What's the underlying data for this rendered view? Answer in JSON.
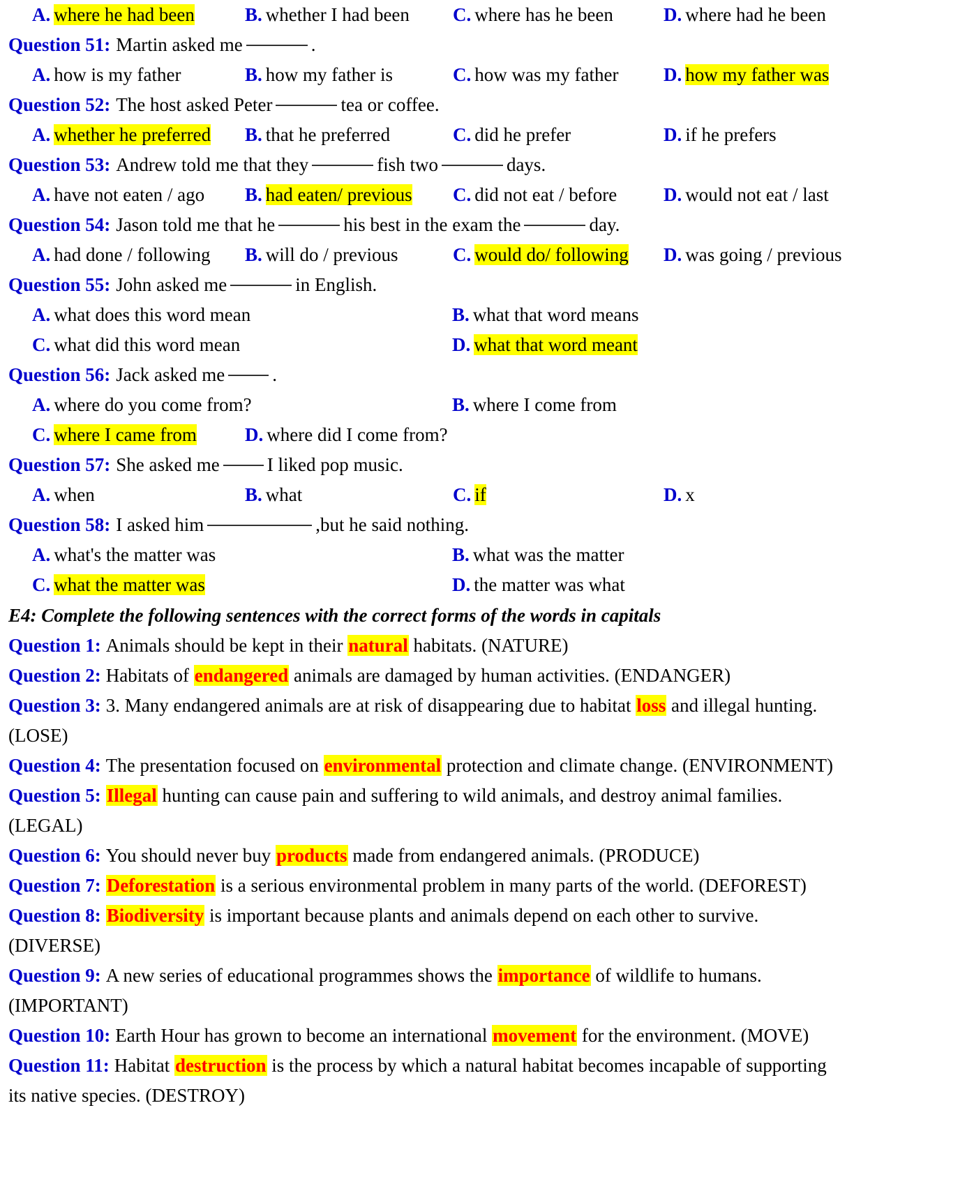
{
  "document": {
    "colors": {
      "question_label": "#0000CC",
      "option_letter": "#0000CC",
      "highlight": "#FFFF00",
      "answer_word": "#FF0000",
      "body_text": "#000000"
    }
  },
  "top_options": {
    "a": {
      "letter": "A.",
      "text": "where he had been"
    },
    "b": {
      "letter": "B.",
      "text": "whether I had been"
    },
    "c": {
      "letter": "C.",
      "text": "where has he been"
    },
    "d": {
      "letter": "D.",
      "text": "where had he been"
    }
  },
  "questions": [
    {
      "label": "Question 51:",
      "stem_before": "Martin asked me",
      "stem_after": ".",
      "options": [
        {
          "letter": "A.",
          "text": "how is my father"
        },
        {
          "letter": "B.",
          "text": "how my father is"
        },
        {
          "letter": "C.",
          "text": "how was my father"
        },
        {
          "letter": "D.",
          "text": "how my father was"
        }
      ]
    },
    {
      "label": "Question 52:",
      "stem_before": "The host asked Peter",
      "stem_after": "tea or coffee.",
      "options": [
        {
          "letter": "A.",
          "text": "whether he preferred"
        },
        {
          "letter": "B.",
          "text": "that he preferred"
        },
        {
          "letter": "C.",
          "text": "did he prefer"
        },
        {
          "letter": "D.",
          "text": "if he prefers"
        }
      ]
    },
    {
      "label": "Question 53:",
      "stem_before": "Andrew told me that they",
      "stem_mid": "fish two",
      "stem_after": "days.",
      "options": [
        {
          "letter": "A.",
          "text": "have not eaten / ago"
        },
        {
          "letter": "B.",
          "text": "had eaten/ previous"
        },
        {
          "letter": "C.",
          "text": "did not eat / before"
        },
        {
          "letter": "D.",
          "text": "would not eat / last"
        }
      ]
    },
    {
      "label": "Question 54:",
      "stem_before": "Jason told me that he",
      "stem_mid": "his best in the exam the",
      "stem_after": "day.",
      "options": [
        {
          "letter": "A.",
          "text": "had done / following"
        },
        {
          "letter": "B.",
          "text": "will do / previous"
        },
        {
          "letter": "C.",
          "text": "would do/ following"
        },
        {
          "letter": "D.",
          "text": "was going / previous"
        }
      ]
    },
    {
      "label": "Question 55:",
      "stem_before": "John asked me",
      "stem_after": "in English.",
      "options": [
        {
          "letter": "A.",
          "text": "what does this word mean"
        },
        {
          "letter": "B.",
          "text": "what that word means"
        },
        {
          "letter": "C.",
          "text": "what did this word mean"
        },
        {
          "letter": "D.",
          "text": "what that word meant"
        }
      ]
    },
    {
      "label": "Question 56:",
      "stem_before": "Jack asked me",
      "stem_after": ".",
      "options": [
        {
          "letter": "A.",
          "text": "where do you come from?"
        },
        {
          "letter": "B.",
          "text": "where I come from"
        },
        {
          "letter": "C.",
          "text": "where I came from"
        },
        {
          "letter": "D.",
          "text": "where did I come from?"
        }
      ]
    },
    {
      "label": "Question 57:",
      "stem_before": "She asked me",
      "stem_after": "I liked pop music.",
      "options": [
        {
          "letter": "A.",
          "text": "when"
        },
        {
          "letter": "B.",
          "text": "what"
        },
        {
          "letter": "C.",
          "text": "if"
        },
        {
          "letter": "D.",
          "text": "x"
        }
      ]
    },
    {
      "label": "Question 58:",
      "stem_before": "I asked him",
      "stem_after": ",but he said nothing.",
      "options": [
        {
          "letter": "A.",
          "text": "what's the matter was"
        },
        {
          "letter": "B.",
          "text": "what was the matter"
        },
        {
          "letter": "C.",
          "text": "what the matter was"
        },
        {
          "letter": "D.",
          "text": "the matter was what"
        }
      ]
    }
  ],
  "e4": {
    "heading": "E4: Complete the following sentences with the correct forms of the words in capitals",
    "items": [
      {
        "label": "Question 1:",
        "before": "Animals should be kept in their ",
        "answer": "natural",
        "after": " habitats. (NATURE)",
        "continuation": ""
      },
      {
        "label": "Question 2:",
        "before": "Habitats of ",
        "answer": "endangered",
        "after": " animals are damaged by human activities. (ENDANGER)",
        "continuation": ""
      },
      {
        "label": "Question 3:",
        "before": "3. Many endangered animals are at risk of disappearing due to habitat ",
        "answer": "loss",
        "after": " and illegal hunting.",
        "continuation": "(LOSE)"
      },
      {
        "label": "Question 4:",
        "before": "The presentation focused on ",
        "answer": "environmental",
        "after": " protection and climate change. (ENVIRONMENT)",
        "continuation": ""
      },
      {
        "label": "Question 5:",
        "before": "",
        "answer": "Illegal",
        "after": " hunting can cause pain and suffering to wild animals, and destroy animal families.",
        "continuation": "(LEGAL)"
      },
      {
        "label": "Question 6:",
        "before": "You should never buy ",
        "answer": "products",
        "after": " made from endangered animals. (PRODUCE)",
        "continuation": ""
      },
      {
        "label": "Question 7:",
        "before": "",
        "answer": "Deforestation",
        "after": " is a serious environmental problem in many parts of the world. (DEFOREST)",
        "continuation": ""
      },
      {
        "label": "Question 8:",
        "before": "",
        "answer": "Biodiversity",
        "after": " is important because plants and animals depend on each other to survive.",
        "continuation": "(DIVERSE)"
      },
      {
        "label": "Question 9:",
        "before": "A new series of educational programmes shows the ",
        "answer": "importance",
        "after": " of wildlife to humans.",
        "continuation": "(IMPORTANT)"
      },
      {
        "label": "Question 10:",
        "before": "Earth Hour has grown to become an international ",
        "answer": "movement",
        "after": " for the environment. (MOVE)",
        "continuation": ""
      },
      {
        "label": "Question 11:",
        "before": "Habitat ",
        "answer": "destruction",
        "after": " is the process by which a natural habitat becomes incapable of supporting",
        "continuation": "its native species. (DESTROY)"
      }
    ]
  }
}
